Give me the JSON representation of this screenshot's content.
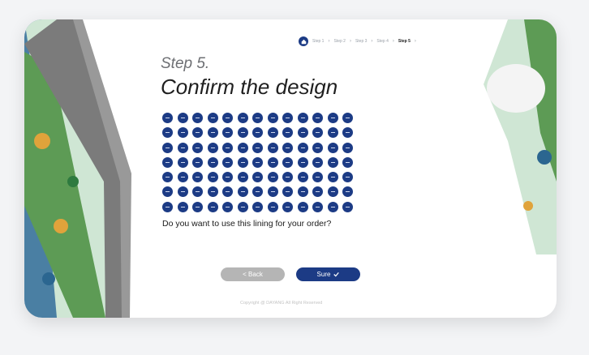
{
  "stepper": {
    "steps": [
      "Step 1",
      "Step 2",
      "Step 3",
      "Step 4",
      "Step 5"
    ],
    "active_index": 4
  },
  "page": {
    "step_label": "Step 5.",
    "title": "Confirm the design",
    "question": "Do you want to use this lining for your order?"
  },
  "buttons": {
    "back": "< Back",
    "sure": "Sure"
  },
  "footer": {
    "copyright": "Copyright @ DAYANG All Right Reserved"
  },
  "swatch_grid": {
    "rows": 7,
    "columns": 13
  },
  "colors": {
    "brand": "#1c3b85",
    "back_button": "#b5b5b5"
  }
}
